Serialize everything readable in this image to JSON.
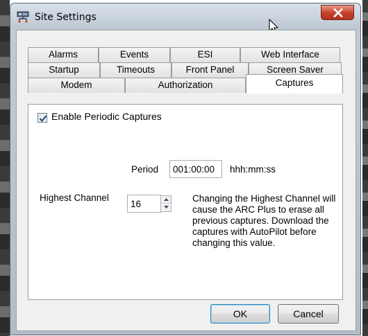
{
  "window": {
    "title": "Site Settings"
  },
  "tabs": {
    "row1": [
      {
        "label": "Alarms"
      },
      {
        "label": "Events"
      },
      {
        "label": "ESI"
      },
      {
        "label": "Web Interface"
      }
    ],
    "row2": [
      {
        "label": "Startup"
      },
      {
        "label": "Timeouts"
      },
      {
        "label": "Front Panel"
      },
      {
        "label": "Screen Saver"
      }
    ],
    "row3": [
      {
        "label": "Modem"
      },
      {
        "label": "Authorization"
      },
      {
        "label": "Captures",
        "active": true
      }
    ]
  },
  "captures": {
    "enable_label": "Enable Periodic Captures",
    "enable_checked": true,
    "period_label": "Period",
    "period_value": "001:00:00",
    "period_format": "hhh:mm:ss",
    "highest_channel_label": "Highest Channel",
    "highest_channel_value": "16",
    "warning_text": "Changing the Highest Channel will cause the ARC Plus to erase all previous captures.  Download the captures with AutoPilot before changing this value."
  },
  "buttons": {
    "ok": "OK",
    "cancel": "Cancel"
  },
  "colors": {
    "close_button": "#c4402c",
    "checkbox_check": "#2a4f7d",
    "default_button_border": "#3c7fb1"
  },
  "icons": {
    "app": "site-settings-app-icon",
    "close": "close-icon",
    "cursor": "mouse-pointer-icon"
  }
}
